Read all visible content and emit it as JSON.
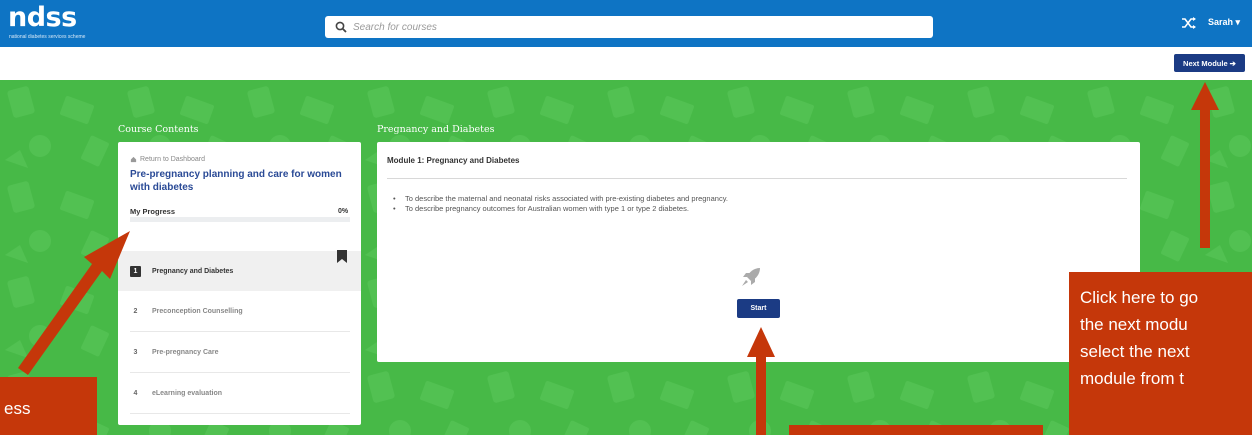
{
  "header": {
    "logo": "ndss",
    "logo_tagline": "national diabetes services scheme",
    "search_placeholder": "Search for courses",
    "user_name": "Sarah"
  },
  "toolbar": {
    "next_module_label": "Next Module"
  },
  "sidebar": {
    "title": "Course Contents",
    "return_label": "Return to Dashboard",
    "course_title": "Pre-pregnancy planning and care for women with diabetes",
    "progress_label": "My Progress",
    "progress_percent": "0%",
    "progress_value": 0,
    "modules": [
      {
        "number": "1",
        "label": "Pregnancy and Diabetes",
        "active": true
      },
      {
        "number": "2",
        "label": "Preconception Counselling"
      },
      {
        "number": "3",
        "label": "Pre-pregnancy Care"
      },
      {
        "number": "4",
        "label": "eLearning evaluation"
      }
    ]
  },
  "main": {
    "section_title": "Pregnancy and Diabetes",
    "module_title": "Module 1: Pregnancy and Diabetes",
    "objectives": [
      "To describe the maternal and neonatal risks associated with pre-existing diabetes and pregnancy.",
      "To describe pregnancy outcomes for Australian women with type 1 or type 2 diabetes."
    ],
    "start_label": "Start"
  },
  "annotations": {
    "right_callout_lines": [
      "Click here to go",
      "the next modu",
      "select the next",
      "module from t"
    ],
    "left_callout_text": "ess"
  },
  "colors": {
    "header_blue": "#0e74c4",
    "navy": "#1b3b84",
    "green_bg": "#47b947",
    "callout_red": "#c5370a"
  }
}
